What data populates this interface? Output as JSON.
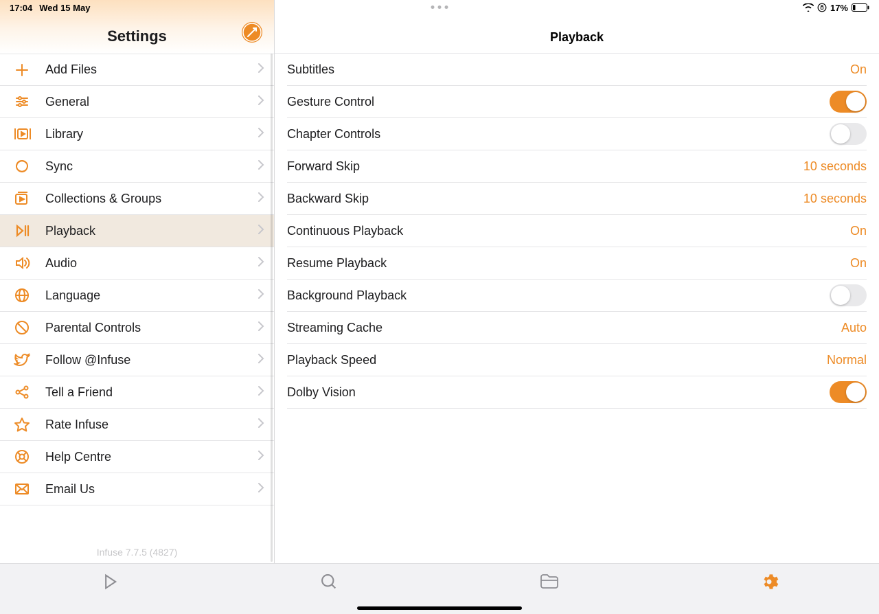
{
  "status": {
    "time": "17:04",
    "date": "Wed 15 May",
    "battery_pct": "17%"
  },
  "sidebar": {
    "title": "Settings",
    "items": [
      {
        "label": "Add Files",
        "icon": "plus-icon"
      },
      {
        "label": "General",
        "icon": "sliders-icon"
      },
      {
        "label": "Library",
        "icon": "library-icon"
      },
      {
        "label": "Sync",
        "icon": "sync-icon"
      },
      {
        "label": "Collections & Groups",
        "icon": "collections-icon"
      },
      {
        "label": "Playback",
        "icon": "playback-icon",
        "selected": true
      },
      {
        "label": "Audio",
        "icon": "audio-icon"
      },
      {
        "label": "Language",
        "icon": "globe-icon"
      },
      {
        "label": "Parental Controls",
        "icon": "parental-icon"
      },
      {
        "label": "Follow @Infuse",
        "icon": "twitter-icon"
      },
      {
        "label": "Tell a Friend",
        "icon": "share-icon"
      },
      {
        "label": "Rate Infuse",
        "icon": "star-icon"
      },
      {
        "label": "Help Centre",
        "icon": "help-icon"
      },
      {
        "label": "Email Us",
        "icon": "email-icon"
      }
    ],
    "version": "Infuse 7.7.5 (4827)"
  },
  "detail": {
    "title": "Playback",
    "rows": [
      {
        "label": "Subtitles",
        "type": "value",
        "value": "On"
      },
      {
        "label": "Gesture Control",
        "type": "switch",
        "on": true
      },
      {
        "label": "Chapter Controls",
        "type": "switch",
        "on": false
      },
      {
        "label": "Forward Skip",
        "type": "value",
        "value": "10 seconds"
      },
      {
        "label": "Backward Skip",
        "type": "value",
        "value": "10 seconds"
      },
      {
        "label": "Continuous Playback",
        "type": "value",
        "value": "On"
      },
      {
        "label": "Resume Playback",
        "type": "value",
        "value": "On"
      },
      {
        "label": "Background Playback",
        "type": "switch",
        "on": false
      },
      {
        "label": "Streaming Cache",
        "type": "value",
        "value": "Auto"
      },
      {
        "label": "Playback Speed",
        "type": "value",
        "value": "Normal"
      },
      {
        "label": "Dolby Vision",
        "type": "switch",
        "on": true
      }
    ]
  },
  "tabs": [
    {
      "name": "play",
      "icon": "play-tab-icon",
      "active": false
    },
    {
      "name": "search",
      "icon": "search-tab-icon",
      "active": false
    },
    {
      "name": "files",
      "icon": "files-tab-icon",
      "active": false
    },
    {
      "name": "settings",
      "icon": "gear-tab-icon",
      "active": true
    }
  ],
  "colors": {
    "accent": "#ed8b26"
  }
}
